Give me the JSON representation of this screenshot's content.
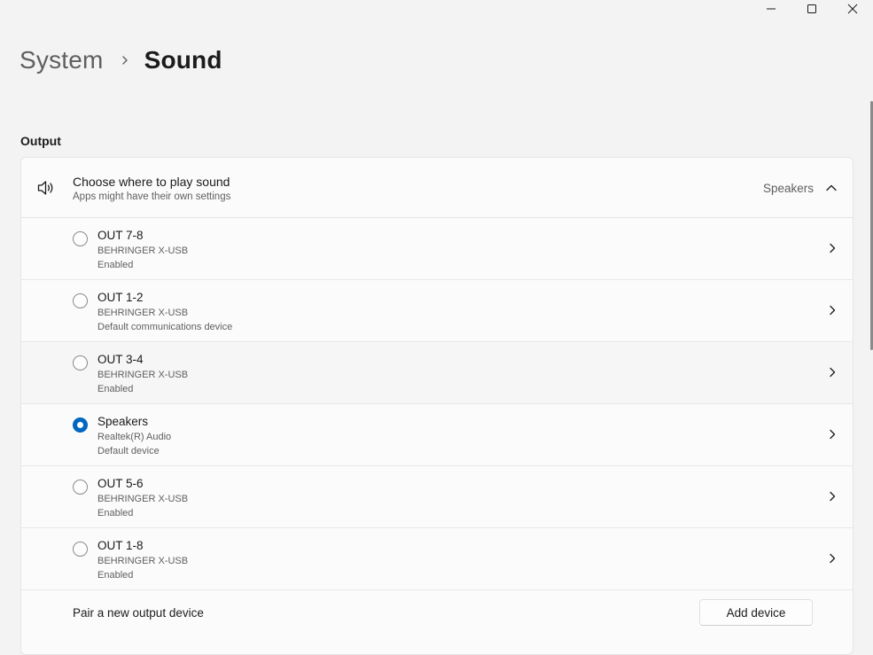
{
  "window": {
    "minimize_icon": "minimize-icon",
    "maximize_icon": "maximize-icon",
    "close_icon": "close-icon"
  },
  "breadcrumb": {
    "parent": "System",
    "current": "Sound"
  },
  "output": {
    "section_title": "Output",
    "header": {
      "title": "Choose where to play sound",
      "subtitle": "Apps might have their own settings",
      "selected_value": "Speakers",
      "icon": "speaker-volume-icon",
      "expanded": true
    },
    "devices": [
      {
        "name": "OUT 7-8",
        "driver": "BEHRINGER X-USB",
        "status": "Enabled",
        "selected": false
      },
      {
        "name": "OUT 1-2",
        "driver": "BEHRINGER X-USB",
        "status": "Default communications device",
        "selected": false
      },
      {
        "name": "OUT 3-4",
        "driver": "BEHRINGER X-USB",
        "status": "Enabled",
        "selected": false
      },
      {
        "name": "Speakers",
        "driver": "Realtek(R) Audio",
        "status": "Default device",
        "selected": true
      },
      {
        "name": "OUT 5-6",
        "driver": "BEHRINGER X-USB",
        "status": "Enabled",
        "selected": false
      },
      {
        "name": "OUT 1-8",
        "driver": "BEHRINGER X-USB",
        "status": "Enabled",
        "selected": false
      }
    ],
    "pair": {
      "label": "Pair a new output device",
      "button": "Add device"
    }
  },
  "colors": {
    "accent": "#0067c0",
    "background": "#f3f3f3",
    "card": "#fbfbfb"
  }
}
